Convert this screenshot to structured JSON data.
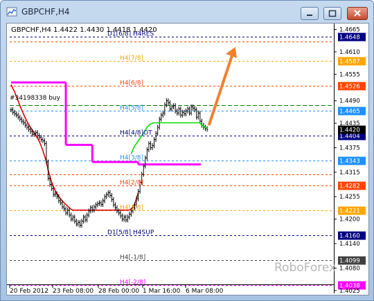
{
  "window": {
    "title": "GBPCHF,H4"
  },
  "colors": {
    "price_bar": "#000000",
    "ma_red": "#e00000",
    "ma_green": "#00e000",
    "magenta_line": "#ff00ff",
    "arrow": "#f08030",
    "watermark": "#b8b8b8"
  },
  "chart_data": {
    "type": "candlestick",
    "symbol": "GBPCHF,H4",
    "info_line": "GBPCHF,H4  1.4422 1.4430 1.4418 1.4420",
    "ylim": [
      1.4018,
      1.4676
    ],
    "y_ticks": [
      "1.4665",
      "1.4610",
      "1.4555",
      "1.4490",
      "1.4435",
      "1.4375",
      "1.4315",
      "1.4255",
      "1.4200",
      "1.4140",
      "1.4080",
      "1.4025"
    ],
    "x_ticks": [
      "20 Feb 2012",
      "23 Feb 08:00",
      "28 Feb 00:00",
      "1 Mar 16:00",
      "6 Mar 08:00"
    ],
    "current_price": "1.4420",
    "levels": [
      {
        "label": "D1[6/8] H4RES",
        "value": 1.4648,
        "value_text": "1.4648",
        "color": "#000080",
        "tag_bg": "#000080",
        "tag_fg": "#ffffff"
      },
      {
        "label": "",
        "value": 1.4635,
        "value_text": "",
        "color": "#ff4500",
        "tag_bg": "",
        "tag_fg": ""
      },
      {
        "label": "H4[7/8]",
        "value": 1.4587,
        "value_text": "1.4587",
        "color": "#ffa500",
        "tag_bg": "#ffa500",
        "tag_fg": "#ffffff"
      },
      {
        "label": "H4[6/8]",
        "value": 1.4526,
        "value_text": "1.4526",
        "color": "#ff4500",
        "tag_bg": "#ff4500",
        "tag_fg": "#ffffff"
      },
      {
        "label": "",
        "value": 1.448,
        "value_text": "",
        "color": "#008000",
        "tag_bg": "",
        "tag_fg": ""
      },
      {
        "label": "H4[5/8]",
        "value": 1.4465,
        "value_text": "1.4465",
        "color": "#1e90ff",
        "tag_bg": "#1e90ff",
        "tag_fg": "#ffffff"
      },
      {
        "label": "H4[4/8]OT",
        "value": 1.4404,
        "value_text": "1.4404",
        "color": "#000080",
        "tag_bg": "#000080",
        "tag_fg": "#ffffff"
      },
      {
        "label": "H4[3/8]",
        "value": 1.4343,
        "value_text": "1.4343",
        "color": "#1e90ff",
        "tag_bg": "#1e90ff",
        "tag_fg": "#ffffff"
      },
      {
        "label": "",
        "value": 1.431,
        "value_text": "",
        "color": "#ff4500",
        "tag_bg": "",
        "tag_fg": ""
      },
      {
        "label": "H4[2/8]",
        "value": 1.4282,
        "value_text": "1.4282",
        "color": "#ff4500",
        "tag_bg": "#ff4500",
        "tag_fg": "#ffffff"
      },
      {
        "label": "H4[1/8]",
        "value": 1.4221,
        "value_text": "1.4221",
        "color": "#ffa500",
        "tag_bg": "#ffa500",
        "tag_fg": "#ffffff"
      },
      {
        "label": "D1[5/8] H4SUP",
        "value": 1.416,
        "value_text": "1.4160",
        "color": "#000080",
        "tag_bg": "#000080",
        "tag_fg": "#ffffff"
      },
      {
        "label": "H4[-1/8]",
        "value": 1.4099,
        "value_text": "1.4099",
        "color": "#404040",
        "tag_bg": "#404040",
        "tag_fg": "#ffffff"
      },
      {
        "label": "H4[-2/8]",
        "value": 1.4038,
        "value_text": "1.4038",
        "color": "#ff00ff",
        "tag_bg": "#ff00ff",
        "tag_fg": "#ffffff"
      }
    ],
    "order_label": "#34198338 buy",
    "current_tag": {
      "value": 1.442,
      "text": "1.4420"
    },
    "candles_close": [
      1.4468,
      1.4462,
      1.4458,
      1.4455,
      1.445,
      1.4445,
      1.444,
      1.4436,
      1.443,
      1.4425,
      1.442,
      1.4415,
      1.4408,
      1.441,
      1.4412,
      1.4405,
      1.44,
      1.4395,
      1.4392,
      1.4385,
      1.434,
      1.43,
      1.4285,
      1.4275,
      1.426,
      1.4262,
      1.4255,
      1.4245,
      1.424,
      1.423,
      1.4225,
      1.4215,
      1.4222,
      1.421,
      1.42,
      1.4205,
      1.4195,
      1.4188,
      1.4192,
      1.4185,
      1.4195,
      1.4205,
      1.4198,
      1.421,
      1.422,
      1.4228,
      1.4222,
      1.423,
      1.4235,
      1.4238,
      1.424,
      1.4236,
      1.4245,
      1.4255,
      1.426,
      1.4265,
      1.4258,
      1.4248,
      1.4235,
      1.4228,
      1.422,
      1.4215,
      1.4208,
      1.42,
      1.4205,
      1.4198,
      1.4205,
      1.4212,
      1.422,
      1.4228,
      1.4235,
      1.425,
      1.4268,
      1.429,
      1.431,
      1.433,
      1.435,
      1.437,
      1.4385,
      1.4375,
      1.438,
      1.4395,
      1.441,
      1.4425,
      1.4445,
      1.4455,
      1.446,
      1.448,
      1.449,
      1.4485,
      1.447,
      1.4475,
      1.4478,
      1.4465,
      1.446,
      1.447,
      1.4455,
      1.4462,
      1.4458,
      1.4465,
      1.447,
      1.446,
      1.4475,
      1.4472,
      1.4468,
      1.445,
      1.446,
      1.444,
      1.443,
      1.4425,
      1.4422,
      1.442
    ],
    "ma_red": [
      1.453,
      1.452,
      1.4512,
      1.45,
      1.449,
      1.4478,
      1.4468,
      1.4458,
      1.4448,
      1.444,
      1.4432,
      1.4425,
      1.4418,
      1.4412,
      1.4405,
      1.4398,
      1.439,
      1.438,
      1.4368,
      1.4355,
      1.434,
      1.432,
      1.4305,
      1.429,
      1.428,
      1.427,
      1.4262,
      1.4255,
      1.425,
      1.4245,
      1.424,
      1.4236,
      1.4232,
      1.4228,
      1.4224,
      1.4222,
      1.4222,
      1.4222,
      1.4222,
      1.4222,
      1.4222,
      1.4222,
      1.4222,
      1.4222,
      1.4222,
      1.4222,
      1.4222,
      1.4222,
      1.4222,
      1.4222,
      1.4222,
      1.4222,
      1.4222,
      1.4222,
      1.4222,
      1.4222,
      1.4222,
      1.4222,
      1.4222,
      1.4222,
      1.4222,
      1.4222,
      1.4222,
      1.4222,
      1.4222,
      1.4222,
      1.4222,
      1.4222,
      1.4225,
      1.423,
      1.4238,
      1.425,
      1.4265
    ],
    "ma_green": [
      1.436,
      1.437,
      1.438,
      1.4385,
      1.4392,
      1.4398,
      1.4404,
      1.441,
      1.4418,
      1.4425,
      1.443,
      1.4433,
      1.4435,
      1.4436,
      1.4436,
      1.4436,
      1.4436,
      1.4436,
      1.4436,
      1.4436,
      1.4436,
      1.4436,
      1.4436,
      1.4436,
      1.4436,
      1.4436,
      1.4436,
      1.4436,
      1.4436,
      1.4436,
      1.4436,
      1.4436,
      1.4436,
      1.4436,
      1.4436,
      1.4436,
      1.4436,
      1.4436,
      1.4436,
      1.4436,
      1.443,
      1.4428,
      1.4425,
      1.4422
    ],
    "magenta_segments": [
      {
        "from": 0,
        "to": 31,
        "value": 1.4535
      },
      {
        "from": 31,
        "to": 46,
        "value": 1.4382
      },
      {
        "from": 46,
        "to": 72,
        "value": 1.434
      },
      {
        "from": 72,
        "to": 150,
        "value": 1.4334
      }
    ],
    "arrow": {
      "from": {
        "x": 112,
        "y": 1.443
      },
      "to": {
        "x": 127,
        "y": 1.4622
      }
    },
    "watermark": "RoboForex"
  }
}
